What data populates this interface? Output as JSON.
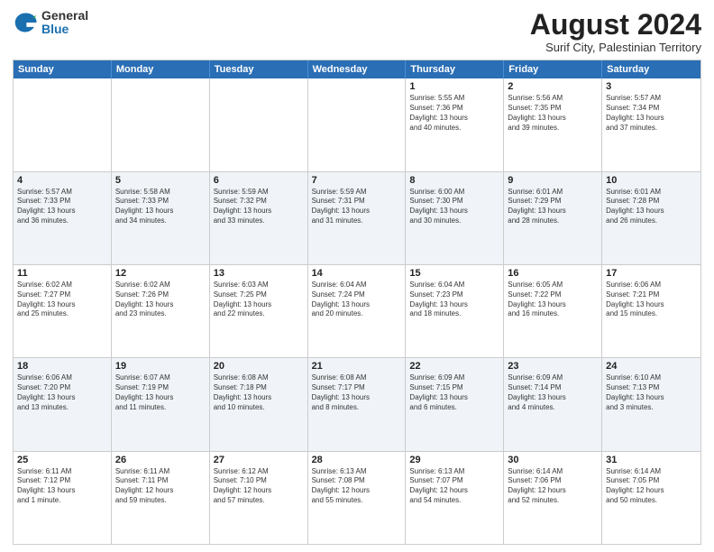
{
  "logo": {
    "general": "General",
    "blue": "Blue"
  },
  "header": {
    "month_year": "August 2024",
    "subtitle": "Surif City, Palestinian Territory"
  },
  "days_of_week": [
    "Sunday",
    "Monday",
    "Tuesday",
    "Wednesday",
    "Thursday",
    "Friday",
    "Saturday"
  ],
  "rows": [
    {
      "alt": false,
      "cells": [
        {
          "day": "",
          "lines": []
        },
        {
          "day": "",
          "lines": []
        },
        {
          "day": "",
          "lines": []
        },
        {
          "day": "",
          "lines": []
        },
        {
          "day": "1",
          "lines": [
            "Sunrise: 5:55 AM",
            "Sunset: 7:36 PM",
            "Daylight: 13 hours",
            "and 40 minutes."
          ]
        },
        {
          "day": "2",
          "lines": [
            "Sunrise: 5:56 AM",
            "Sunset: 7:35 PM",
            "Daylight: 13 hours",
            "and 39 minutes."
          ]
        },
        {
          "day": "3",
          "lines": [
            "Sunrise: 5:57 AM",
            "Sunset: 7:34 PM",
            "Daylight: 13 hours",
            "and 37 minutes."
          ]
        }
      ]
    },
    {
      "alt": true,
      "cells": [
        {
          "day": "4",
          "lines": [
            "Sunrise: 5:57 AM",
            "Sunset: 7:33 PM",
            "Daylight: 13 hours",
            "and 36 minutes."
          ]
        },
        {
          "day": "5",
          "lines": [
            "Sunrise: 5:58 AM",
            "Sunset: 7:33 PM",
            "Daylight: 13 hours",
            "and 34 minutes."
          ]
        },
        {
          "day": "6",
          "lines": [
            "Sunrise: 5:59 AM",
            "Sunset: 7:32 PM",
            "Daylight: 13 hours",
            "and 33 minutes."
          ]
        },
        {
          "day": "7",
          "lines": [
            "Sunrise: 5:59 AM",
            "Sunset: 7:31 PM",
            "Daylight: 13 hours",
            "and 31 minutes."
          ]
        },
        {
          "day": "8",
          "lines": [
            "Sunrise: 6:00 AM",
            "Sunset: 7:30 PM",
            "Daylight: 13 hours",
            "and 30 minutes."
          ]
        },
        {
          "day": "9",
          "lines": [
            "Sunrise: 6:01 AM",
            "Sunset: 7:29 PM",
            "Daylight: 13 hours",
            "and 28 minutes."
          ]
        },
        {
          "day": "10",
          "lines": [
            "Sunrise: 6:01 AM",
            "Sunset: 7:28 PM",
            "Daylight: 13 hours",
            "and 26 minutes."
          ]
        }
      ]
    },
    {
      "alt": false,
      "cells": [
        {
          "day": "11",
          "lines": [
            "Sunrise: 6:02 AM",
            "Sunset: 7:27 PM",
            "Daylight: 13 hours",
            "and 25 minutes."
          ]
        },
        {
          "day": "12",
          "lines": [
            "Sunrise: 6:02 AM",
            "Sunset: 7:26 PM",
            "Daylight: 13 hours",
            "and 23 minutes."
          ]
        },
        {
          "day": "13",
          "lines": [
            "Sunrise: 6:03 AM",
            "Sunset: 7:25 PM",
            "Daylight: 13 hours",
            "and 22 minutes."
          ]
        },
        {
          "day": "14",
          "lines": [
            "Sunrise: 6:04 AM",
            "Sunset: 7:24 PM",
            "Daylight: 13 hours",
            "and 20 minutes."
          ]
        },
        {
          "day": "15",
          "lines": [
            "Sunrise: 6:04 AM",
            "Sunset: 7:23 PM",
            "Daylight: 13 hours",
            "and 18 minutes."
          ]
        },
        {
          "day": "16",
          "lines": [
            "Sunrise: 6:05 AM",
            "Sunset: 7:22 PM",
            "Daylight: 13 hours",
            "and 16 minutes."
          ]
        },
        {
          "day": "17",
          "lines": [
            "Sunrise: 6:06 AM",
            "Sunset: 7:21 PM",
            "Daylight: 13 hours",
            "and 15 minutes."
          ]
        }
      ]
    },
    {
      "alt": true,
      "cells": [
        {
          "day": "18",
          "lines": [
            "Sunrise: 6:06 AM",
            "Sunset: 7:20 PM",
            "Daylight: 13 hours",
            "and 13 minutes."
          ]
        },
        {
          "day": "19",
          "lines": [
            "Sunrise: 6:07 AM",
            "Sunset: 7:19 PM",
            "Daylight: 13 hours",
            "and 11 minutes."
          ]
        },
        {
          "day": "20",
          "lines": [
            "Sunrise: 6:08 AM",
            "Sunset: 7:18 PM",
            "Daylight: 13 hours",
            "and 10 minutes."
          ]
        },
        {
          "day": "21",
          "lines": [
            "Sunrise: 6:08 AM",
            "Sunset: 7:17 PM",
            "Daylight: 13 hours",
            "and 8 minutes."
          ]
        },
        {
          "day": "22",
          "lines": [
            "Sunrise: 6:09 AM",
            "Sunset: 7:15 PM",
            "Daylight: 13 hours",
            "and 6 minutes."
          ]
        },
        {
          "day": "23",
          "lines": [
            "Sunrise: 6:09 AM",
            "Sunset: 7:14 PM",
            "Daylight: 13 hours",
            "and 4 minutes."
          ]
        },
        {
          "day": "24",
          "lines": [
            "Sunrise: 6:10 AM",
            "Sunset: 7:13 PM",
            "Daylight: 13 hours",
            "and 3 minutes."
          ]
        }
      ]
    },
    {
      "alt": false,
      "cells": [
        {
          "day": "25",
          "lines": [
            "Sunrise: 6:11 AM",
            "Sunset: 7:12 PM",
            "Daylight: 13 hours",
            "and 1 minute."
          ]
        },
        {
          "day": "26",
          "lines": [
            "Sunrise: 6:11 AM",
            "Sunset: 7:11 PM",
            "Daylight: 12 hours",
            "and 59 minutes."
          ]
        },
        {
          "day": "27",
          "lines": [
            "Sunrise: 6:12 AM",
            "Sunset: 7:10 PM",
            "Daylight: 12 hours",
            "and 57 minutes."
          ]
        },
        {
          "day": "28",
          "lines": [
            "Sunrise: 6:13 AM",
            "Sunset: 7:08 PM",
            "Daylight: 12 hours",
            "and 55 minutes."
          ]
        },
        {
          "day": "29",
          "lines": [
            "Sunrise: 6:13 AM",
            "Sunset: 7:07 PM",
            "Daylight: 12 hours",
            "and 54 minutes."
          ]
        },
        {
          "day": "30",
          "lines": [
            "Sunrise: 6:14 AM",
            "Sunset: 7:06 PM",
            "Daylight: 12 hours",
            "and 52 minutes."
          ]
        },
        {
          "day": "31",
          "lines": [
            "Sunrise: 6:14 AM",
            "Sunset: 7:05 PM",
            "Daylight: 12 hours",
            "and 50 minutes."
          ]
        }
      ]
    }
  ]
}
